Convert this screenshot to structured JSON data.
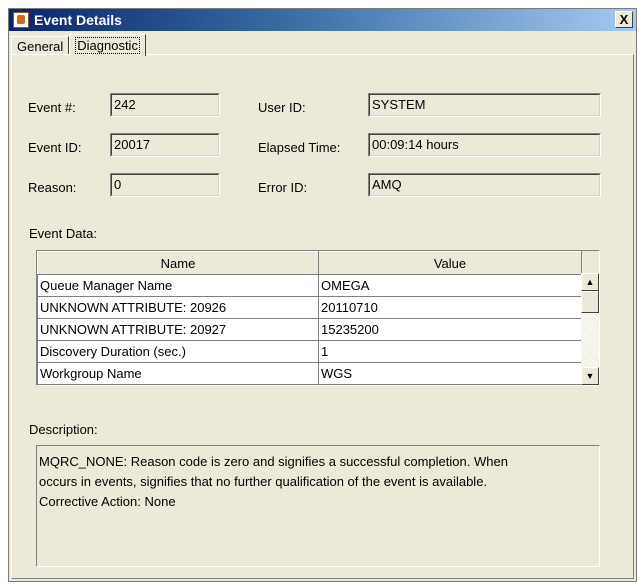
{
  "window": {
    "title": "Event Details",
    "close_label": "X"
  },
  "tabs": [
    {
      "label": "General"
    },
    {
      "label": "Diagnostic"
    }
  ],
  "fields": {
    "event_num": {
      "label": "Event #:",
      "value": "242"
    },
    "event_id": {
      "label": "Event ID:",
      "value": "20017"
    },
    "reason": {
      "label": "Reason:",
      "value": "0"
    },
    "user_id": {
      "label": "User ID:",
      "value": "SYSTEM"
    },
    "elapsed_time": {
      "label": "Elapsed Time:",
      "value": "00:09:14 hours"
    },
    "error_id": {
      "label": "Error ID:",
      "value": "AMQ"
    }
  },
  "event_data": {
    "label": "Event Data:",
    "columns": [
      "Name",
      "Value"
    ],
    "rows": [
      [
        "Queue Manager Name",
        "OMEGA"
      ],
      [
        "UNKNOWN ATTRIBUTE: 20926",
        "20110710"
      ],
      [
        "UNKNOWN ATTRIBUTE: 20927",
        "15235200"
      ],
      [
        "Discovery Duration (sec.)",
        "1"
      ],
      [
        "Workgroup Name",
        "WGS"
      ]
    ]
  },
  "description": {
    "label": "Description:",
    "lines": [
      "MQRC_NONE: Reason code is zero and signifies a successful completion. When",
      "occurs in events, signifies that no further qualification of the event is available.",
      "Corrective Action: None"
    ]
  },
  "icons": {
    "app": "java-app-icon",
    "close": "close-icon",
    "scroll_up": "scroll-up-arrow-icon",
    "scroll_down": "scroll-down-arrow-icon"
  },
  "colors": {
    "title_gradient_start": "#0A246A",
    "title_gradient_end": "#A6CAF0",
    "window_bg": "#ECE9D8"
  }
}
